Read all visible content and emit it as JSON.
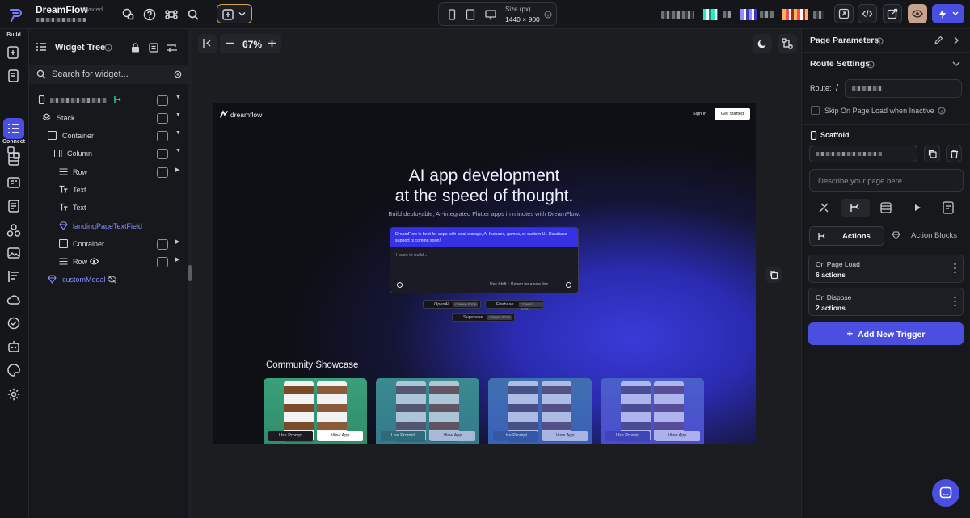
{
  "app": {
    "name": "DreamFlow",
    "status": "Synced"
  },
  "topbar": {
    "size_label": "Size (px)",
    "size_value": "1440 × 900"
  },
  "rail": {
    "build": "Build",
    "connect": "Connect"
  },
  "tree": {
    "title": "Widget Tree",
    "search_placeholder": "Search for widget...",
    "nodes": [
      "Stack",
      "Container",
      "Column",
      "Row",
      "Text",
      "Text",
      "landingPageTextField",
      "Container",
      "Row",
      "customModal"
    ]
  },
  "canvas": {
    "zoom": "67%"
  },
  "preview": {
    "brand": "dreamflow",
    "sign_in": "Sign In",
    "get_started": "Get Started",
    "hero_line1": "AI app development",
    "hero_line2": "at the speed of thought.",
    "hero_sub": "Build deployable, AI-integrated Flutter apps in minutes with DreamFlow.",
    "notice": "DreamFlow is best for apps with local storage, AI features, games, or custom UI. Database support is coming soon!",
    "prompt_placeholder": "I want to build...",
    "prompt_hint": "Use Shift + Return for a new line",
    "integrations": [
      {
        "name": "OpenAI",
        "tag": "COMING SOON"
      },
      {
        "name": "Firebase",
        "tag": "COMING SOON"
      },
      {
        "name": "Supabase",
        "tag": "COMING SOON"
      }
    ],
    "showcase_title": "Community Showcase",
    "cards": [
      {
        "prompt": "Use Prompt",
        "view": "View App"
      },
      {
        "prompt": "Use Prompt",
        "view": "View App"
      },
      {
        "prompt": "Use Prompt",
        "view": "View App"
      },
      {
        "prompt": "Use Prompt",
        "view": "View App"
      }
    ]
  },
  "props": {
    "page_params": "Page Parameters",
    "route_settings": "Route Settings",
    "route_label": "Route:",
    "route_slash": "/",
    "skip_label": "Skip On Page Load when Inactive",
    "scaffold": "Scaffold",
    "describe_placeholder": "Describe your page here...",
    "tab_actions": "Actions",
    "tab_blocks": "Action Blocks",
    "triggers": [
      {
        "name": "On Page Load",
        "count": "6 actions"
      },
      {
        "name": "On Dispose",
        "count": "2 actions"
      }
    ],
    "add_trigger": "Add New Trigger"
  },
  "colors": {
    "accent": "#4a4fe0",
    "bg": "#15161a",
    "highlight": "#d9a04a"
  }
}
